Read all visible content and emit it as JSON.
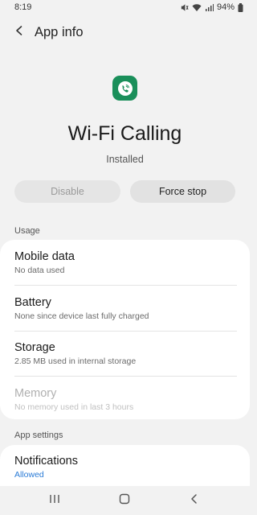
{
  "status_bar": {
    "time": "8:19",
    "battery_percent": "94%",
    "icons": [
      "mute-icon",
      "wifi-icon",
      "signal-icon",
      "battery-icon"
    ]
  },
  "app_bar": {
    "title": "App info"
  },
  "app": {
    "name": "Wi-Fi Calling",
    "status": "Installed",
    "icon": "wifi-calling-icon",
    "icon_color": "#1a8f5a"
  },
  "actions": {
    "disable_label": "Disable",
    "force_stop_label": "Force stop"
  },
  "usage": {
    "section_label": "Usage",
    "items": [
      {
        "title": "Mobile data",
        "subtitle": "No data used"
      },
      {
        "title": "Battery",
        "subtitle": "None since device last fully charged"
      },
      {
        "title": "Storage",
        "subtitle": "2.85 MB used in internal storage"
      },
      {
        "title": "Memory",
        "subtitle": "No memory used in last 3 hours"
      }
    ]
  },
  "app_settings": {
    "section_label": "App settings",
    "items": [
      {
        "title": "Notifications",
        "subtitle": "Allowed"
      }
    ]
  },
  "colors": {
    "accent": "#2a7bd6",
    "background": "#f2f2f2"
  },
  "nav_bar": {
    "icons": [
      "recents-icon",
      "home-icon",
      "back-icon"
    ]
  }
}
